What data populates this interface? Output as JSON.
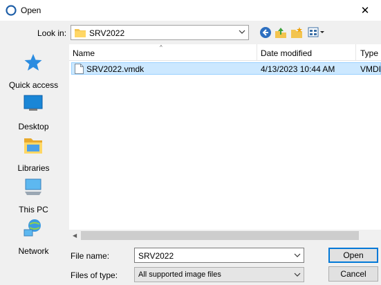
{
  "window": {
    "title": "Open",
    "close_glyph": "✕"
  },
  "toolbar": {
    "look_in_label": "Look in:",
    "look_in_value": "SRV2022",
    "icons": [
      "back-icon",
      "up-folder-icon",
      "new-folder-icon",
      "view-menu-icon"
    ]
  },
  "places": [
    {
      "label": "Quick access",
      "icon": "star-icon"
    },
    {
      "label": "Desktop",
      "icon": "desktop-icon"
    },
    {
      "label": "Libraries",
      "icon": "libraries-icon"
    },
    {
      "label": "This PC",
      "icon": "pc-icon"
    },
    {
      "label": "Network",
      "icon": "network-icon"
    }
  ],
  "columns": [
    "Name",
    "Date modified",
    "Type"
  ],
  "files": [
    {
      "name": "SRV2022.vmdk",
      "date_modified": "4/13/2023 10:44 AM",
      "type": "VMDI",
      "selected": true
    }
  ],
  "form": {
    "file_name_label": "File name:",
    "file_name_value": "SRV2022",
    "file_type_label": "Files of type:",
    "file_type_value": "All supported image files"
  },
  "buttons": {
    "open": "Open",
    "cancel": "Cancel"
  },
  "colors": {
    "accent": "#0078d7",
    "selection": "#cce8ff",
    "selection_border": "#99d1ff"
  }
}
